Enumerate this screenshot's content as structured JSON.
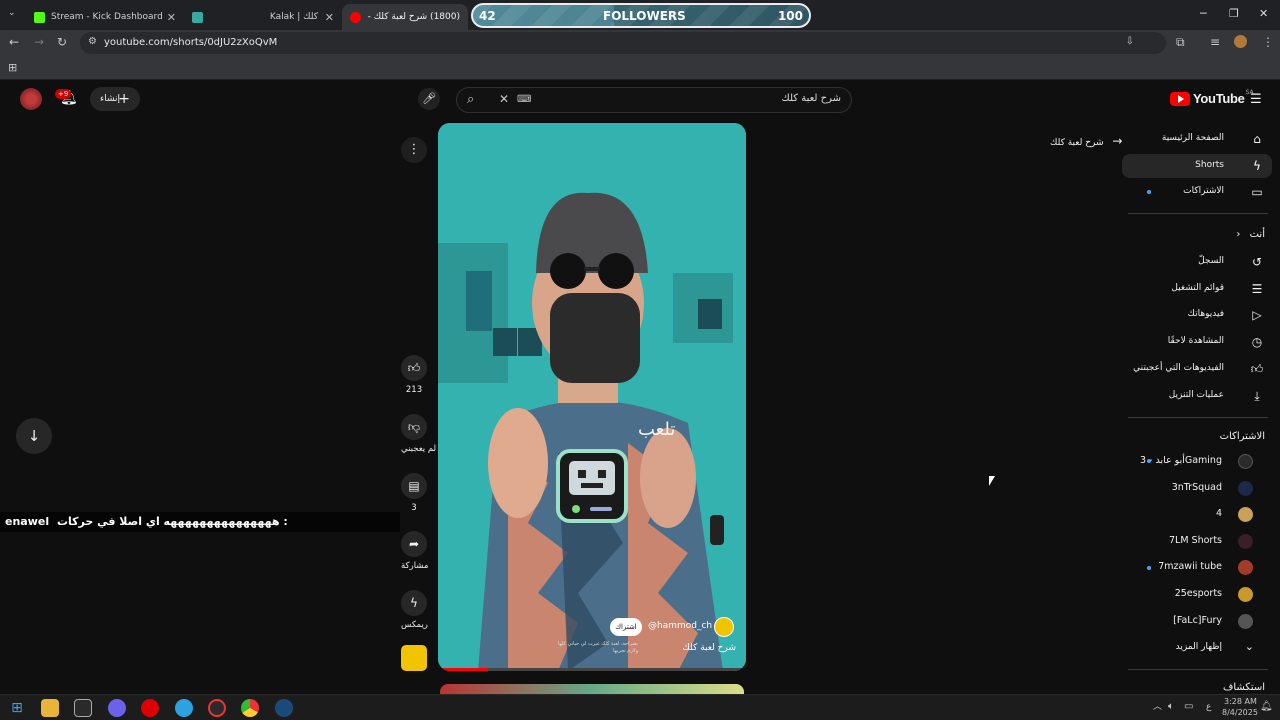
{
  "browser": {
    "tabs": [
      {
        "title": "Stream - Kick Dashboard",
        "favicon_color": "#53fc18"
      },
      {
        "title": "",
        "favicon_color": "#3aa9a0"
      },
      {
        "title": "Kalak | كلك",
        "favicon_color": ""
      },
      {
        "title": "(1800) شرح لعبة كلك - YouTube",
        "favicon_color": "#ff0000"
      }
    ],
    "url": "youtube.com/shorts/0dJU2zXoQvM"
  },
  "followers_widget": {
    "current": "42",
    "label": "FOLLOWERS",
    "goal": "100",
    "progress": 0.42
  },
  "header": {
    "create_label": "إنشاء",
    "notification_badge": "+9",
    "search_query": "شرح لعبة كلك",
    "logo_text": "YouTube",
    "logo_region": "SA"
  },
  "sidebar": {
    "main": [
      {
        "label": "الصفحة الرئيسية",
        "icon": "home-icon"
      },
      {
        "label": "Shorts",
        "icon": "shorts-icon"
      },
      {
        "label": "الاشتراكات",
        "icon": "subscriptions-icon"
      }
    ],
    "you_header": "أنت",
    "you": [
      {
        "label": "السجلّ",
        "icon": "history-icon"
      },
      {
        "label": "قوائم التشغيل",
        "icon": "playlists-icon"
      },
      {
        "label": "فيديوهاتك",
        "icon": "your-videos-icon"
      },
      {
        "label": "المشاهدة لاحقًا",
        "icon": "watch-later-icon"
      },
      {
        "label": "الفيديوهات التي أعجبتني",
        "icon": "liked-icon"
      },
      {
        "label": "عمليات التنزيل",
        "icon": "download-icon"
      }
    ],
    "subscriptions_header": "الاشتراكات",
    "subscriptions": [
      {
        "name": "أبو عابد - 3Gaming",
        "color": "#2b2b2b",
        "new": true
      },
      {
        "name": "3nTrSquad",
        "color": "#1b2a4a",
        "new": false
      },
      {
        "name": "4",
        "color": "#c9a15a",
        "new": false
      },
      {
        "name": "7LM Shorts",
        "color": "#3a1f2a",
        "new": false
      },
      {
        "name": "7mzawii tube",
        "color": "#a33a2a",
        "new": true
      },
      {
        "name": "25esports",
        "color": "#c79a2a",
        "new": false
      },
      {
        "name": "[FaLc]Fury",
        "color": "#555555",
        "new": false
      }
    ],
    "show_more": "إظهار المزيد",
    "explore_header": "استكشاف"
  },
  "back_link": "شرح لعبة كلك",
  "short": {
    "caption": "تلعب",
    "channel": "@hammod_ch",
    "subscribe_label": "اشتراك",
    "title": "شرح لعبة كلك",
    "description": "بصراحة، لعبة كلك غيرت لي حياتي كلها ولازم تجربها",
    "likes": "213",
    "dislike_label": "لم يعجبني",
    "comments": "3",
    "share_label": "مشاركة",
    "remix_label": "ريمكس"
  },
  "chat_overlay": {
    "user": "enawel",
    "message": "هههههههههههههههه اي اصلا في حركات :"
  },
  "taskbar": {
    "time": "3:28 AM",
    "date": "8/4/2025",
    "lang": "ع"
  }
}
